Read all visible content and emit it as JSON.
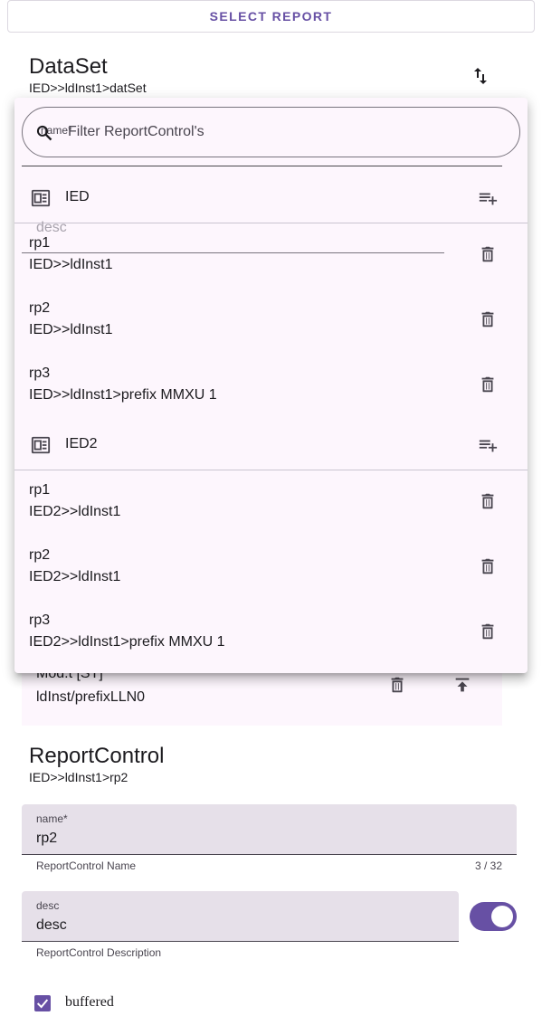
{
  "header": {
    "select_report_label": "SELECT REPORT"
  },
  "dataset": {
    "title": "DataSet",
    "path": "IED>>ldInst1>datSet"
  },
  "background_item": {
    "line1": "Mod.t [ST]",
    "line2": "ldInst/prefixLLN0"
  },
  "filter": {
    "ghost_label": "name*",
    "placeholder": "Filter ReportControl's"
  },
  "ghost_field": {
    "label": "desc"
  },
  "groups": [
    {
      "name": "IED",
      "items": [
        {
          "name": "rp1",
          "path": "IED>>ldInst1"
        },
        {
          "name": "rp2",
          "path": "IED>>ldInst1"
        },
        {
          "name": "rp3",
          "path": "IED>>ldInst1>prefix MMXU 1"
        }
      ]
    },
    {
      "name": "IED2",
      "items": [
        {
          "name": "rp1",
          "path": "IED2>>ldInst1"
        },
        {
          "name": "rp2",
          "path": "IED2>>ldInst1"
        },
        {
          "name": "rp3",
          "path": "IED2>>ldInst1>prefix MMXU 1"
        }
      ]
    }
  ],
  "report_control": {
    "title": "ReportControl",
    "path": "IED>>ldInst1>rp2",
    "name_field": {
      "label": "name*",
      "value": "rp2",
      "helper": "ReportControl Name",
      "counter": "3 / 32"
    },
    "desc_field": {
      "label": "desc",
      "value": "desc",
      "helper": "ReportControl Description"
    },
    "desc_switch_on": true,
    "buffered": {
      "label": "buffered",
      "checked": true
    }
  },
  "colors": {
    "accent": "#6750a4",
    "panel_bg": "#fdf6fd",
    "field_bg": "#e6e0e9"
  }
}
